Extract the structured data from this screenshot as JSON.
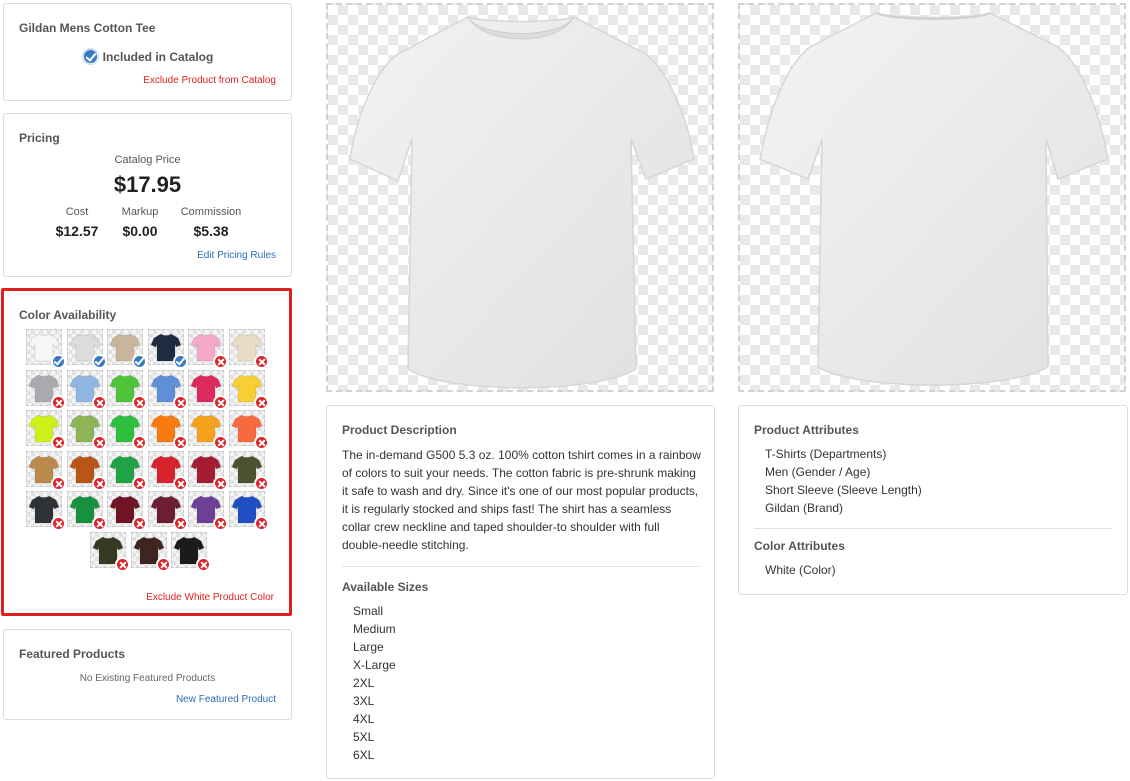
{
  "product_card": {
    "title": "Gildan Mens Cotton Tee",
    "included_label": "Included in Catalog",
    "exclude_link": "Exclude Product from Catalog"
  },
  "pricing": {
    "title": "Pricing",
    "catalog_price_label": "Catalog Price",
    "catalog_price": "$17.95",
    "cost_label": "Cost",
    "cost": "$12.57",
    "markup_label": "Markup",
    "markup": "$0.00",
    "commission_label": "Commission",
    "commission": "$5.38",
    "edit_link": "Edit Pricing Rules"
  },
  "colors": {
    "title": "Color Availability",
    "exclude_link": "Exclude White Product Color",
    "highlight_color": "#dd1f1f",
    "swatches": [
      {
        "color": "#f6f6f6",
        "included": true
      },
      {
        "color": "#dcdcdc",
        "included": true
      },
      {
        "color": "#c9b49c",
        "included": true
      },
      {
        "color": "#1f2b40",
        "included": true
      },
      {
        "color": "#f4a9c8",
        "included": false
      },
      {
        "color": "#e8dcc4",
        "included": false
      },
      {
        "color": "#a9aaad",
        "included": false
      },
      {
        "color": "#8fb6e3",
        "included": false
      },
      {
        "color": "#4fc43a",
        "included": false
      },
      {
        "color": "#5f8fd8",
        "included": false
      },
      {
        "color": "#dd2a5c",
        "included": false
      },
      {
        "color": "#f7cf35",
        "included": false
      },
      {
        "color": "#ccf21a",
        "included": false
      },
      {
        "color": "#8db555",
        "included": false
      },
      {
        "color": "#2fbf3e",
        "included": false
      },
      {
        "color": "#f87a10",
        "included": false
      },
      {
        "color": "#f6a11c",
        "included": false
      },
      {
        "color": "#f7693f",
        "included": false
      },
      {
        "color": "#b98a4c",
        "included": false
      },
      {
        "color": "#b85517",
        "included": false
      },
      {
        "color": "#1fa344",
        "included": false
      },
      {
        "color": "#d8232c",
        "included": false
      },
      {
        "color": "#a51d32",
        "included": false
      },
      {
        "color": "#4a5230",
        "included": false
      },
      {
        "color": "#2f3338",
        "included": false
      },
      {
        "color": "#17913f",
        "included": false
      },
      {
        "color": "#6e1422",
        "included": false
      },
      {
        "color": "#6b1e34",
        "included": false
      },
      {
        "color": "#6d3f95",
        "included": false
      },
      {
        "color": "#1f4fc2",
        "included": false
      },
      {
        "color": "#353b22",
        "included": false
      },
      {
        "color": "#3e2520",
        "included": false
      },
      {
        "color": "#1b1b1b",
        "included": false
      }
    ]
  },
  "featured": {
    "title": "Featured Products",
    "empty_text": "No Existing Featured Products",
    "new_link": "New Featured Product"
  },
  "images": {
    "front_icon": "tshirt-front",
    "back_icon": "tshirt-back",
    "shirt_color": "#ebebeb"
  },
  "description": {
    "title": "Product Description",
    "text": "The in-demand G500 5.3 oz. 100% cotton tshirt comes in a rainbow of colors to suit your needs. The cotton fabric is pre-shrunk making it safe to wash and dry. Since it's one of our most popular products, it is regularly stocked and ships fast! The shirt has a seamless collar crew neckline and taped shoulder-to shoulder with full double-needle stitching.",
    "sizes_title": "Available Sizes",
    "sizes": [
      "Small",
      "Medium",
      "Large",
      "X-Large",
      "2XL",
      "3XL",
      "4XL",
      "5XL",
      "6XL"
    ]
  },
  "attributes": {
    "title": "Product Attributes",
    "items": [
      "T-Shirts (Departments)",
      "Men (Gender / Age)",
      "Short Sleeve (Sleeve Length)",
      "Gildan (Brand)"
    ],
    "color_title": "Color Attributes",
    "color_items": [
      "White (Color)"
    ]
  }
}
